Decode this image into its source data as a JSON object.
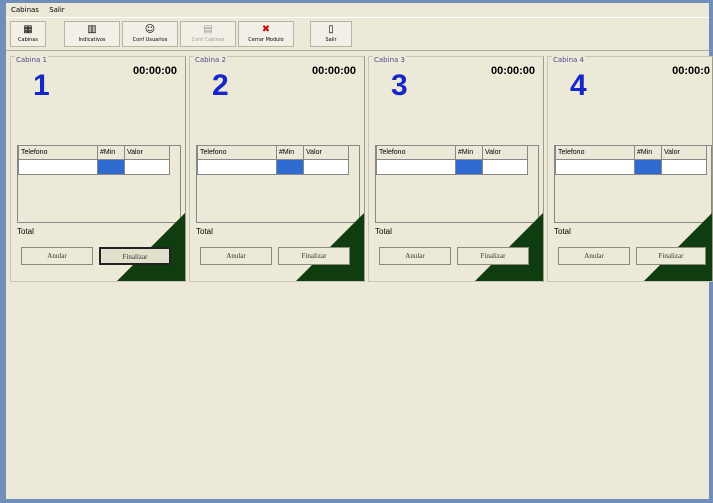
{
  "menu": [
    "Cabinas",
    "Salir"
  ],
  "toolbar": [
    {
      "label": "Cabinas",
      "icon": "cabins-icon",
      "glyph": "▦",
      "enabled": true
    },
    {
      "label": "Indicativos",
      "icon": "phone-book-icon",
      "glyph": "▥",
      "enabled": true
    },
    {
      "label": "Conf Usuarios",
      "icon": "user-icon",
      "glyph": "☺",
      "enabled": true
    },
    {
      "label": "Conf Cabinas",
      "icon": "grid-icon",
      "glyph": "▤",
      "enabled": false
    },
    {
      "label": "Cerrar Modulo",
      "icon": "close-module-icon",
      "glyph": "✖",
      "enabled": true
    },
    {
      "label": "Salir",
      "icon": "exit-door-icon",
      "glyph": "▯",
      "enabled": true
    }
  ],
  "cabinas": [
    {
      "title": "Cabina 1",
      "number": "1",
      "time": "00:00:00"
    },
    {
      "title": "Cabina 2",
      "number": "2",
      "time": "00:00:00"
    },
    {
      "title": "Cabina 3",
      "number": "3",
      "time": "00:00:00"
    },
    {
      "title": "Cabina 4",
      "number": "4",
      "time": "00:00:0"
    }
  ],
  "grid_headers": [
    "Telefono",
    "#Min",
    "Valor"
  ],
  "total_label": "Total",
  "anular_label": "Anular",
  "finalizar_label": "Finalizar",
  "colors": {
    "accent": "#1527c9",
    "selection": "#2f6bd0",
    "frame": "#6f8fb9",
    "triangle": "#103d10"
  }
}
